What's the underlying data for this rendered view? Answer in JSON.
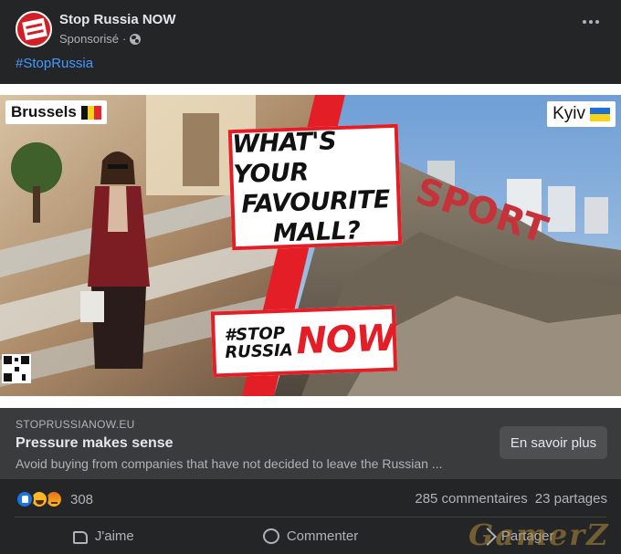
{
  "header": {
    "page_name": "Stop Russia NOW",
    "sponsored_label": "Sponsorisé",
    "separator": "·",
    "audience_icon": "globe-icon",
    "menu_icon": "more-horizontal-icon"
  },
  "post": {
    "hashtag": "#StopRussia"
  },
  "image": {
    "left_tag": "Brussels",
    "right_tag": "Kyiv",
    "headline": [
      "WHAT'S YOUR",
      "FAVOURITE",
      "MALL?"
    ],
    "logo_small": [
      "#STOP",
      "RUSSIA"
    ],
    "logo_big": "NOW",
    "ruin_text": "SPORT",
    "accent_color": "#e41e26"
  },
  "link": {
    "domain": "STOPRUSSIANOW.EU",
    "title": "Pressure makes sense",
    "description": "Avoid buying from companies that have not decided to leave the Russian ...",
    "cta": "En savoir plus"
  },
  "engagement": {
    "reaction_icons": [
      "like-reaction-icon",
      "haha-reaction-icon",
      "angry-reaction-icon"
    ],
    "reaction_count": "308",
    "comments": "285 commentaires",
    "shares": "23 partages"
  },
  "actions": {
    "like": "J'aime",
    "comment": "Commenter",
    "share": "Partager"
  },
  "watermark": "GamerZ"
}
